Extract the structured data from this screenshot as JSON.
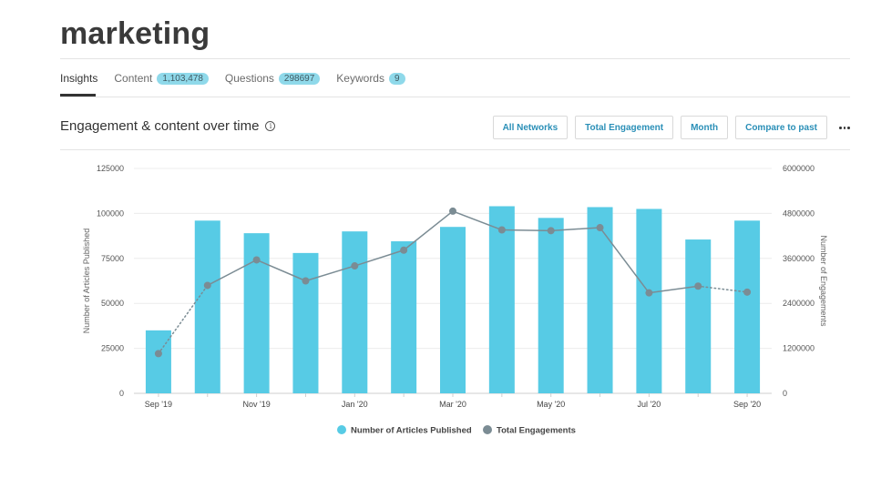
{
  "page": {
    "title": "marketing"
  },
  "tabs": [
    {
      "label": "Insights",
      "count": ""
    },
    {
      "label": "Content",
      "count": "1,103,478"
    },
    {
      "label": "Questions",
      "count": "298697"
    },
    {
      "label": "Keywords",
      "count": "9"
    }
  ],
  "section": {
    "title": "Engagement & content over time"
  },
  "toolbar": {
    "networks": "All Networks",
    "metric": "Total Engagement",
    "period": "Month",
    "compare": "Compare to past"
  },
  "colors": {
    "bar": "#57cbe5",
    "line": "#7b8c94",
    "accent": "#2a8fb7",
    "badge": "#8fd9ea"
  },
  "chart_data": {
    "type": "bar",
    "x_tick_labels": [
      "Sep '19",
      "",
      "Nov '19",
      "",
      "Jan '20",
      "",
      "Mar '20",
      "",
      "May '20",
      "",
      "Jul '20",
      "",
      "Sep '20"
    ],
    "ylabel": "Number of Articles Published",
    "y2label": "Number of Engagements",
    "ylim": [
      0,
      125000
    ],
    "y_ticks": [
      "0",
      "25000",
      "50000",
      "75000",
      "100000",
      "125000"
    ],
    "y2lim": [
      0,
      6000000
    ],
    "y2_ticks": [
      "0",
      "1200000",
      "2400000",
      "3600000",
      "4800000",
      "6000000"
    ],
    "grid": true,
    "legend_position": "bottom",
    "series": [
      {
        "name": "Number of Articles Published",
        "type": "bar",
        "values": [
          35000,
          96000,
          89000,
          78000,
          90000,
          84500,
          92500,
          104000,
          97500,
          103500,
          102500,
          85500,
          96000
        ]
      },
      {
        "name": "Total Engagements",
        "type": "line",
        "axis": "right",
        "values": [
          1060000,
          2880000,
          3560000,
          3000000,
          3400000,
          3820000,
          4860000,
          4360000,
          4340000,
          4420000,
          2680000,
          2860000,
          2700000
        ],
        "dotted_segments": [
          0,
          11
        ]
      }
    ]
  }
}
